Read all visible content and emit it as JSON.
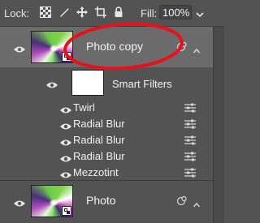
{
  "toolbar": {
    "lock_label": "Lock:",
    "lock_icons": [
      "lock-transparent-pixels-icon",
      "lock-image-pixels-icon",
      "lock-position-icon",
      "artboard-nesting-icon",
      "lock-all-icon"
    ],
    "fill_label": "Fill:",
    "fill_value": "100%"
  },
  "layers": [
    {
      "name": "Photo copy",
      "selected": true,
      "smart_object": true,
      "icons": [
        "smart-filter-toggle-icon",
        "chevron-up-icon"
      ]
    },
    {
      "name": "Photo",
      "selected": false,
      "smart_object": true,
      "icons": [
        "smart-filter-toggle-icon",
        "chevron-up-icon"
      ]
    }
  ],
  "smart_filters": {
    "label": "Smart Filters",
    "items": [
      {
        "name": "Twirl"
      },
      {
        "name": "Radial Blur"
      },
      {
        "name": "Radial Blur"
      },
      {
        "name": "Radial Blur"
      },
      {
        "name": "Mezzotint"
      }
    ]
  },
  "annotation_color": "#e8101a",
  "selection_color": "#6b6b6b",
  "panel_color": "#535353"
}
